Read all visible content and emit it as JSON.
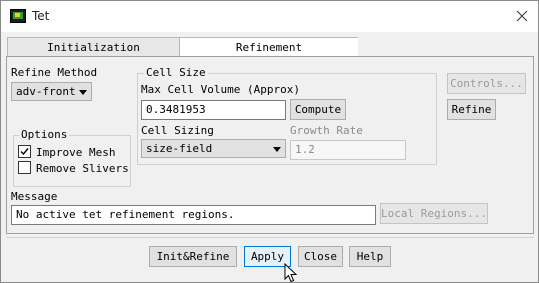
{
  "window": {
    "title": "Tet",
    "icons": {
      "app": "mesh-app-icon",
      "close": "close-icon"
    }
  },
  "tabs": [
    {
      "label": "Initialization",
      "active": false
    },
    {
      "label": "Refinement",
      "active": true
    }
  ],
  "refine_method": {
    "label": "Refine Method",
    "value": "adv-front"
  },
  "options": {
    "title": "Options",
    "improve_mesh": {
      "label": "Improve Mesh",
      "checked": true
    },
    "remove_slivers": {
      "label": "Remove Slivers",
      "checked": false
    }
  },
  "cell_size": {
    "title": "Cell Size",
    "max_volume_label": "Max Cell Volume (Approx)",
    "max_volume_value": "0.3481953",
    "compute_label": "Compute",
    "sizing_label": "Cell Sizing",
    "sizing_value": "size-field",
    "growth_label": "Growth Rate",
    "growth_value": "1.2"
  },
  "side_buttons": {
    "controls": "Controls...",
    "refine": "Refine"
  },
  "message": {
    "label": "Message",
    "text": "No active tet refinement regions.",
    "local_regions": "Local Regions..."
  },
  "footer": {
    "init_refine": "Init&Refine",
    "apply": "Apply",
    "close": "Close",
    "help": "Help"
  },
  "colors": {
    "focus": "#0078d7",
    "disabled_text": "#8a8a8a"
  }
}
